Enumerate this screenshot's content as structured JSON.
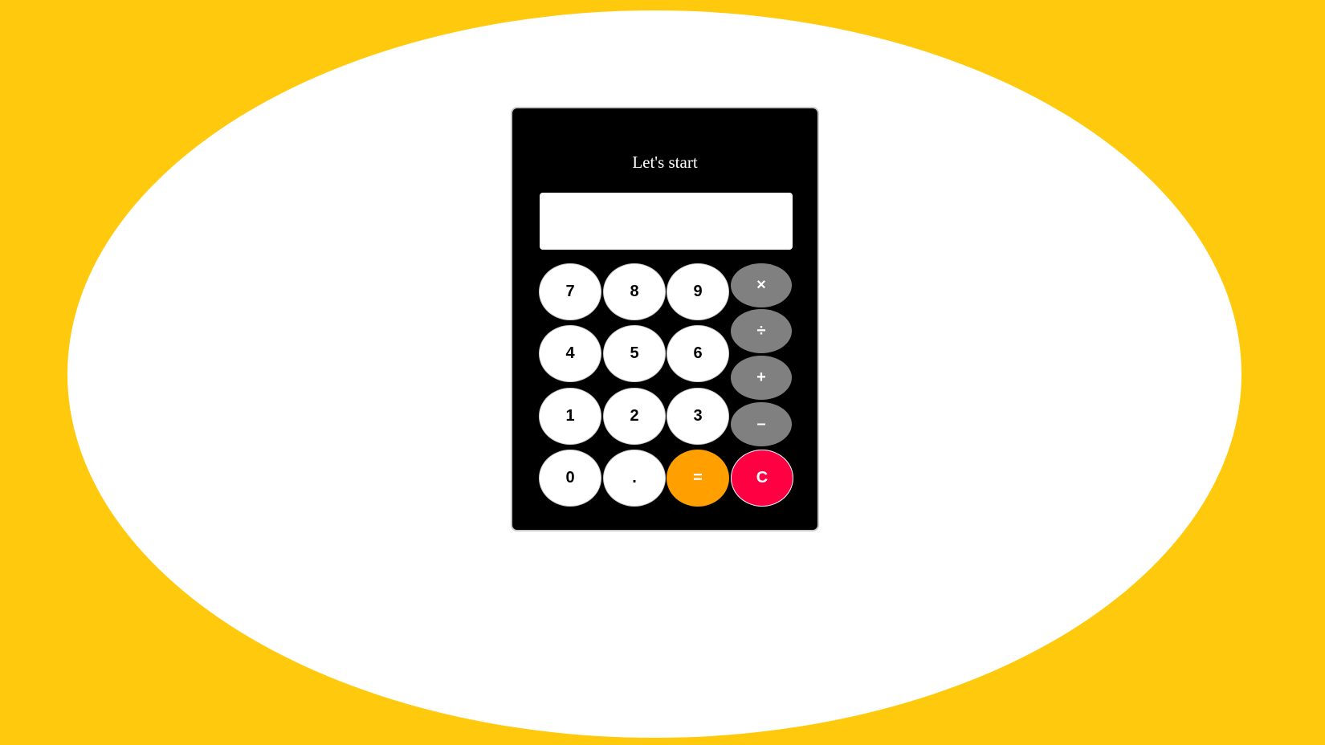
{
  "calculator": {
    "title": "Let's start",
    "display_value": "",
    "keys": {
      "seven": "7",
      "eight": "8",
      "nine": "9",
      "four": "4",
      "five": "5",
      "six": "6",
      "one": "1",
      "two": "2",
      "three": "3",
      "zero": "0",
      "dot": ".",
      "equals": "=",
      "clear": "C",
      "multiply": "×",
      "divide": "÷",
      "add": "+",
      "subtract": "–"
    }
  },
  "colors": {
    "background": "#ffc90e",
    "ellipse": "#ffffff",
    "calculator_body": "#000000",
    "number_key": "#ffffff",
    "operator_key": "#808080",
    "equals_key": "#ff9f00",
    "clear_key": "#ff0042"
  }
}
